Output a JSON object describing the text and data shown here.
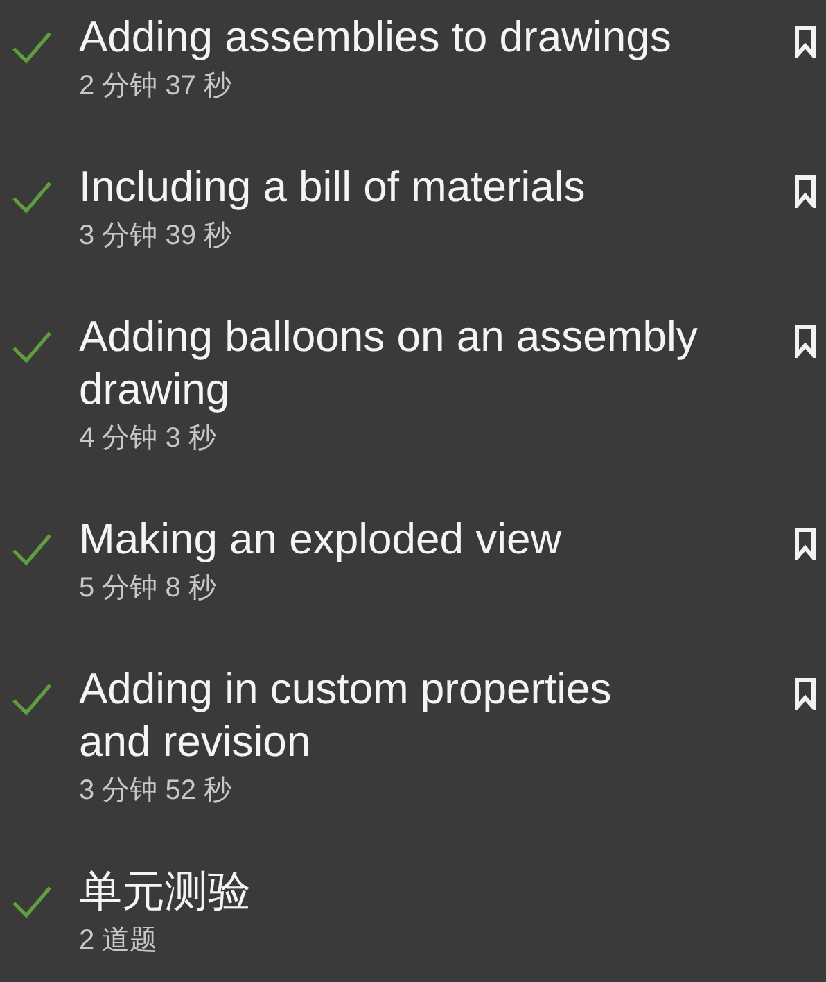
{
  "lessons": [
    {
      "title_lines": [
        "Adding assemblies to drawings"
      ],
      "duration": "2 分钟 37 秒",
      "completed": true,
      "bookmark": true
    },
    {
      "title_lines": [
        "Including a bill of materials"
      ],
      "duration": "3 分钟 39 秒",
      "completed": true,
      "bookmark": true
    },
    {
      "title_lines": [
        "Adding balloons on an assembly",
        "drawing"
      ],
      "duration": "4 分钟 3 秒",
      "completed": true,
      "bookmark": true
    },
    {
      "title_lines": [
        "Making an exploded view"
      ],
      "duration": "5 分钟 8 秒",
      "completed": true,
      "bookmark": true
    },
    {
      "title_lines": [
        "Adding in custom properties",
        "and revision"
      ],
      "duration": "3 分钟 52 秒",
      "completed": true,
      "bookmark": true
    },
    {
      "title_lines": [
        "单元测验"
      ],
      "duration": "2 道题",
      "completed": true,
      "bookmark": false
    }
  ]
}
